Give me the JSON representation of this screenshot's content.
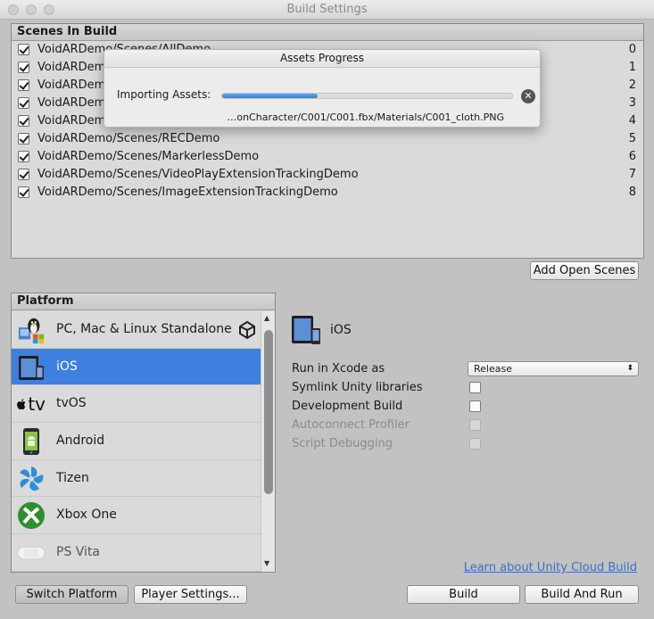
{
  "window": {
    "title": "Build Settings"
  },
  "scenes": {
    "header": "Scenes In Build",
    "items": [
      {
        "name": "VoidARDemo/Scenes/AllDemo",
        "index": "0",
        "checked": true
      },
      {
        "name": "VoidARDemo",
        "index": "1",
        "checked": true
      },
      {
        "name": "VoidARDemo",
        "index": "2",
        "checked": true
      },
      {
        "name": "VoidARDemo",
        "index": "3",
        "checked": true
      },
      {
        "name": "VoidARDemo",
        "index": "4",
        "checked": true
      },
      {
        "name": "VoidARDemo/Scenes/RECDemo",
        "index": "5",
        "checked": true
      },
      {
        "name": "VoidARDemo/Scenes/MarkerlessDemo",
        "index": "6",
        "checked": true
      },
      {
        "name": "VoidARDemo/Scenes/VideoPlayExtensionTrackingDemo",
        "index": "7",
        "checked": true
      },
      {
        "name": "VoidARDemo/Scenes/ImageExtensionTrackingDemo",
        "index": "8",
        "checked": true
      }
    ],
    "add_open_scenes": "Add Open Scenes"
  },
  "progress_dialog": {
    "title": "Assets Progress",
    "label": "Importing Assets:",
    "progress": 0.33,
    "path": "…onCharacter/C001/C001.fbx/Materials/C001_cloth.PNG",
    "accent": "#3d8ae6"
  },
  "platform": {
    "header": "Platform",
    "items": [
      {
        "label": "PC, Mac & Linux Standalone",
        "icon": "standalone-icon",
        "selected": false
      },
      {
        "label": "iOS",
        "icon": "ios-icon",
        "selected": true
      },
      {
        "label": "tvOS",
        "icon": "tvos-icon",
        "selected": false
      },
      {
        "label": "Android",
        "icon": "android-icon",
        "selected": false
      },
      {
        "label": "Tizen",
        "icon": "tizen-icon",
        "selected": false
      },
      {
        "label": "Xbox One",
        "icon": "xbox-icon",
        "selected": false
      },
      {
        "label": "PS Vita",
        "icon": "psvita-icon",
        "selected": false
      }
    ],
    "selected_color": "#3d80df",
    "tvos_mark": "tv"
  },
  "settings": {
    "platform_title": "iOS",
    "run_in_xcode_label": "Run in Xcode as",
    "run_in_xcode_value": "Release",
    "symlink_label": "Symlink Unity libraries",
    "development_build_label": "Development Build",
    "autoconnect_label": "Autoconnect Profiler",
    "script_debugging_label": "Script Debugging"
  },
  "footer": {
    "cloud_link": "Learn about Unity Cloud Build",
    "switch_platform": "Switch Platform",
    "player_settings": "Player Settings...",
    "build": "Build",
    "build_and_run": "Build And Run"
  }
}
